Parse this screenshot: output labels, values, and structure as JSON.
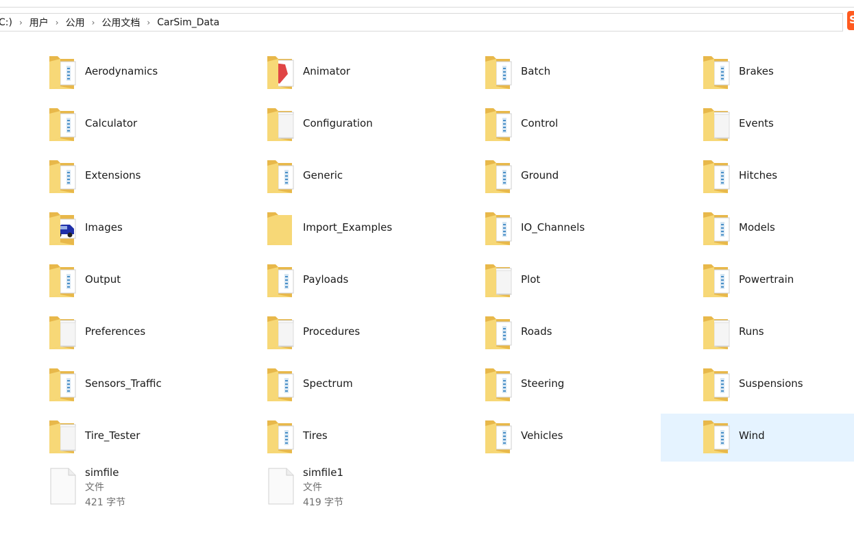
{
  "breadcrumb": {
    "items": [
      "C:)",
      "用户",
      "公用",
      "公用文档",
      "CarSim_Data"
    ],
    "separator": "›"
  },
  "app_icon": {
    "glyph": "S",
    "color": "#ff5a1f"
  },
  "colors": {
    "folder_back": "#e8b84a",
    "folder_front": "#f7d877",
    "selection": "#e5f3ff"
  },
  "folders": [
    {
      "name": "Aerodynamics",
      "icon": "folder-doc-icon"
    },
    {
      "name": "Animator",
      "icon": "folder-red-doc-icon"
    },
    {
      "name": "Batch",
      "icon": "folder-doc-icon"
    },
    {
      "name": "Brakes",
      "icon": "folder-doc-icon"
    },
    {
      "name": "Calculator",
      "icon": "folder-doc-icon"
    },
    {
      "name": "Configuration",
      "icon": "folder-blank-doc-icon"
    },
    {
      "name": "Control",
      "icon": "folder-doc-icon"
    },
    {
      "name": "Events",
      "icon": "folder-blank-doc-icon"
    },
    {
      "name": "Extensions",
      "icon": "folder-doc-icon"
    },
    {
      "name": "Generic",
      "icon": "folder-doc-icon"
    },
    {
      "name": "Ground",
      "icon": "folder-doc-icon"
    },
    {
      "name": "Hitches",
      "icon": "folder-doc-icon"
    },
    {
      "name": "Images",
      "icon": "folder-car-image-icon"
    },
    {
      "name": "Import_Examples",
      "icon": "folder-empty-icon"
    },
    {
      "name": "IO_Channels",
      "icon": "folder-doc-icon"
    },
    {
      "name": "Models",
      "icon": "folder-doc-icon"
    },
    {
      "name": "Output",
      "icon": "folder-doc-icon"
    },
    {
      "name": "Payloads",
      "icon": "folder-doc-icon"
    },
    {
      "name": "Plot",
      "icon": "folder-blank-doc-icon"
    },
    {
      "name": "Powertrain",
      "icon": "folder-doc-icon"
    },
    {
      "name": "Preferences",
      "icon": "folder-blank-doc-icon"
    },
    {
      "name": "Procedures",
      "icon": "folder-blank-doc-icon"
    },
    {
      "name": "Roads",
      "icon": "folder-doc-icon"
    },
    {
      "name": "Runs",
      "icon": "folder-blank-doc-icon"
    },
    {
      "name": "Sensors_Traffic",
      "icon": "folder-doc-icon"
    },
    {
      "name": "Spectrum",
      "icon": "folder-doc-icon"
    },
    {
      "name": "Steering",
      "icon": "folder-doc-icon"
    },
    {
      "name": "Suspensions",
      "icon": "folder-doc-icon"
    },
    {
      "name": "Tire_Tester",
      "icon": "folder-blank-doc-icon"
    },
    {
      "name": "Tires",
      "icon": "folder-doc-icon"
    },
    {
      "name": "Vehicles",
      "icon": "folder-doc-icon"
    },
    {
      "name": "Wind",
      "icon": "folder-doc-icon",
      "selected": true
    }
  ],
  "files": [
    {
      "name": "simfile",
      "type": "文件",
      "size": "421 字节",
      "icon": "file-icon"
    },
    {
      "name": "simfile1",
      "type": "文件",
      "size": "419 字节",
      "icon": "file-icon"
    }
  ]
}
